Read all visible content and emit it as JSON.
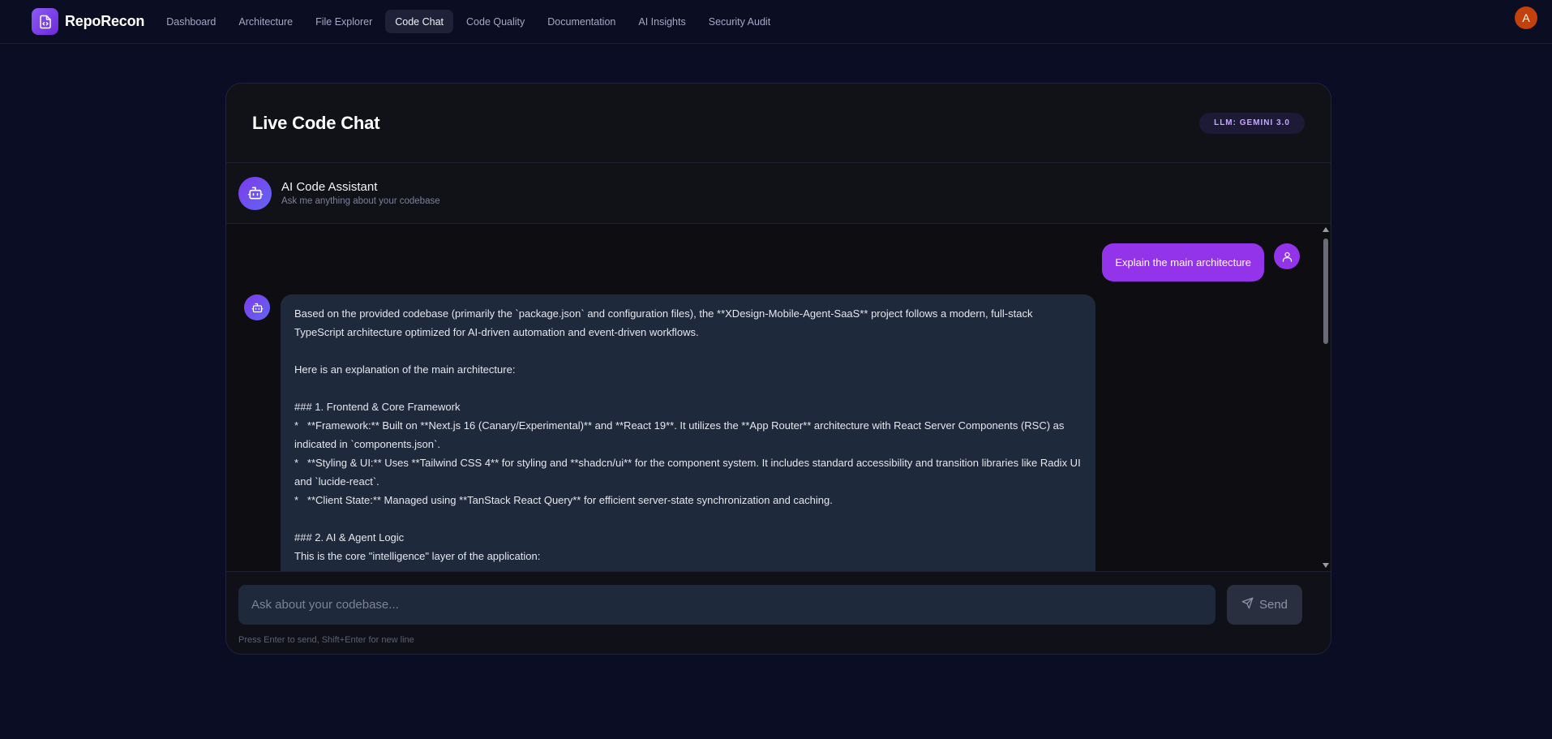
{
  "brand": {
    "name": "RepoRecon",
    "logo_icon": "file-code-icon"
  },
  "nav": {
    "items": [
      {
        "label": "Dashboard",
        "active": false
      },
      {
        "label": "Architecture",
        "active": false
      },
      {
        "label": "File Explorer",
        "active": false
      },
      {
        "label": "Code Chat",
        "active": true
      },
      {
        "label": "Code Quality",
        "active": false
      },
      {
        "label": "Documentation",
        "active": false
      },
      {
        "label": "AI Insights",
        "active": false
      },
      {
        "label": "Security Audit",
        "active": false
      }
    ]
  },
  "user": {
    "initial": "A",
    "avatar_color": "#c2410c"
  },
  "panel": {
    "title": "Live Code Chat",
    "llm_badge": "LLM: GEMINI 3.0"
  },
  "assistant": {
    "name": "AI Code Assistant",
    "subtitle": "Ask me anything about your codebase",
    "icon": "bot-icon"
  },
  "messages": {
    "user_message": "Explain the main architecture",
    "bot_message": "Based on the provided codebase (primarily the `package.json` and configuration files), the **XDesign-Mobile-Agent-SaaS** project follows a modern, full-stack TypeScript architecture optimized for AI-driven automation and event-driven workflows.\n\nHere is an explanation of the main architecture:\n\n### 1. Frontend & Core Framework\n*   **Framework:** Built on **Next.js 16 (Canary/Experimental)** and **React 19**. It utilizes the **App Router** architecture with React Server Components (RSC) as indicated in `components.json`.\n*   **Styling & UI:** Uses **Tailwind CSS 4** for styling and **shadcn/ui** for the component system. It includes standard accessibility and transition libraries like Radix UI and `lucide-react`.\n*   **Client State:** Managed using **TanStack React Query** for efficient server-state synchronization and caching.\n\n### 2. AI & Agent Logic\nThis is the core \"intelligence\" layer of the application:"
  },
  "composer": {
    "placeholder": "Ask about your codebase...",
    "send_label": "Send",
    "hint": "Press Enter to send, Shift+Enter for new line"
  },
  "colors": {
    "accent": "#9333ea",
    "page_bg": "#0b0d24",
    "bubble_bg": "#1e293b"
  }
}
